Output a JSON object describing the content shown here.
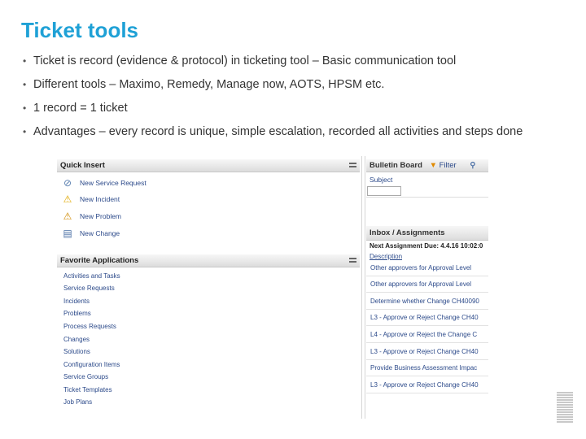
{
  "title": "Ticket tools",
  "bullets": [
    "Ticket is record (evidence & protocol) in ticketing tool – Basic communication tool",
    "Different tools – Maximo, Remedy, Manage now, AOTS, HPSM etc.",
    "1 record  = 1 ticket",
    "Advantages – every record is unique, simple escalation, recorded all activities and steps done"
  ],
  "quick_insert": {
    "header": "Quick Insert",
    "items": [
      {
        "label": "New Service Request",
        "icon": "service-request-icon"
      },
      {
        "label": "New Incident",
        "icon": "warning-icon"
      },
      {
        "label": "New Problem",
        "icon": "problem-icon"
      },
      {
        "label": "New Change",
        "icon": "change-icon"
      }
    ]
  },
  "favorites": {
    "header": "Favorite Applications",
    "items": [
      "Activities and Tasks",
      "Service Requests",
      "Incidents",
      "Problems",
      "Process Requests",
      "Changes",
      "Solutions",
      "Configuration Items",
      "Service Groups",
      "Ticket Templates",
      "Job Plans"
    ]
  },
  "bulletin_board": {
    "header": "Bulletin Board",
    "filter": "Filter",
    "subject_label": "Subject"
  },
  "inbox": {
    "header": "Inbox / Assignments",
    "next_assignment": "Next Assignment Due: 4.4.16 10:02:0",
    "description_label": "Description",
    "rows": [
      "Other approvers for Approval Level",
      "Other approvers for Approval Level",
      "Determine whether Change CH40090",
      "L3 - Approve or Reject Change CH40",
      "L4 - Approve or Reject the Change C",
      "L3 - Approve or Reject Change CH40",
      "Provide Business Assessment Impac",
      "L3 - Approve or Reject Change CH40"
    ]
  },
  "colors": {
    "title": "#1fa1d6",
    "link": "#2c4a8a"
  }
}
